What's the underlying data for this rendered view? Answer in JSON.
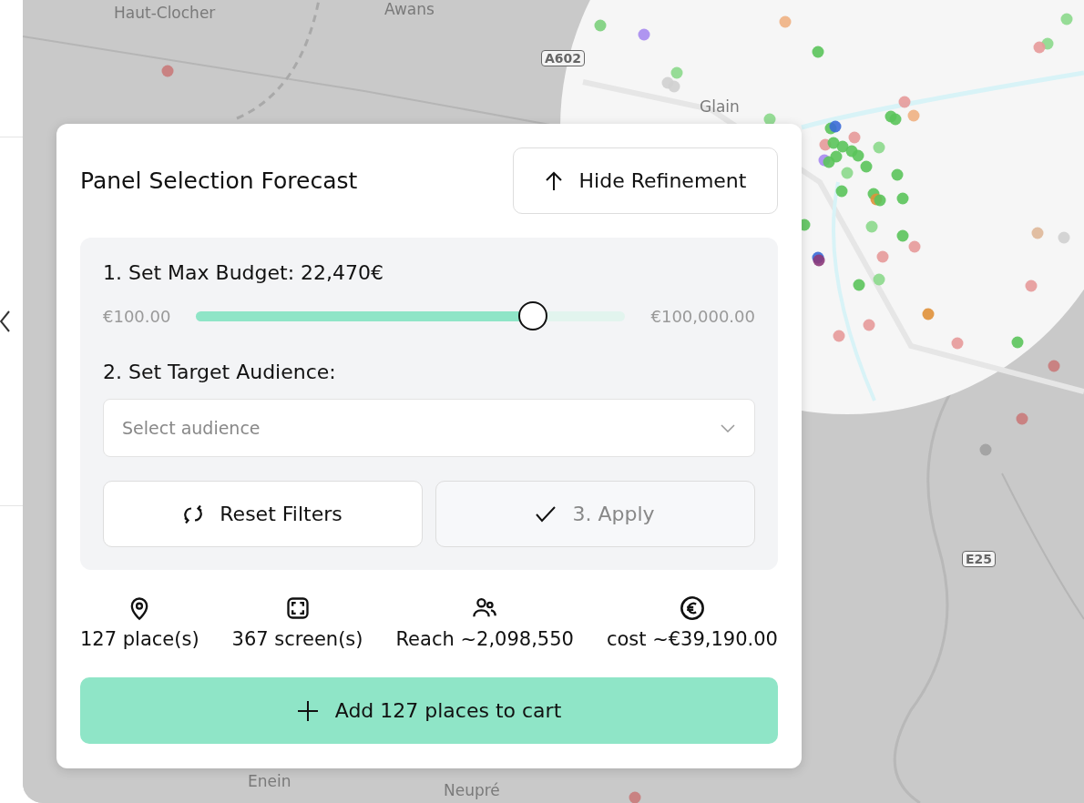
{
  "sidebar": {
    "collapse_control": true
  },
  "map": {
    "labels": [
      {
        "text": "Haut-Clocher",
        "kind": "place"
      },
      {
        "text": "Awans",
        "kind": "place"
      },
      {
        "text": "A602",
        "kind": "road"
      },
      {
        "text": "Glain",
        "kind": "place"
      },
      {
        "text": "E25",
        "kind": "road"
      },
      {
        "text": "Enein",
        "kind": "place"
      },
      {
        "text": "Neupré",
        "kind": "place"
      }
    ]
  },
  "panel": {
    "title": "Panel Selection Forecast",
    "hide_button": {
      "label": "Hide Refinement"
    },
    "budget": {
      "label": "1. Set Max Budget: 22,470€",
      "min": "€100.00",
      "max": "€100,000.00",
      "level": 0.785
    },
    "audience": {
      "label": "2. Set Target Audience:",
      "placeholder": "Select audience"
    },
    "reset_button": {
      "label": "Reset Filters"
    },
    "apply_button": {
      "label": "3. Apply",
      "disabled": true
    },
    "stats": [
      {
        "kind": "places",
        "text": "127 place(s)"
      },
      {
        "kind": "screens",
        "text": "367 screen(s)"
      },
      {
        "kind": "reach",
        "text": "Reach ~2,098,550"
      },
      {
        "kind": "cost",
        "text": "cost ~€39,190.00"
      }
    ],
    "add_button": {
      "label": "Add 127 places to cart"
    }
  }
}
